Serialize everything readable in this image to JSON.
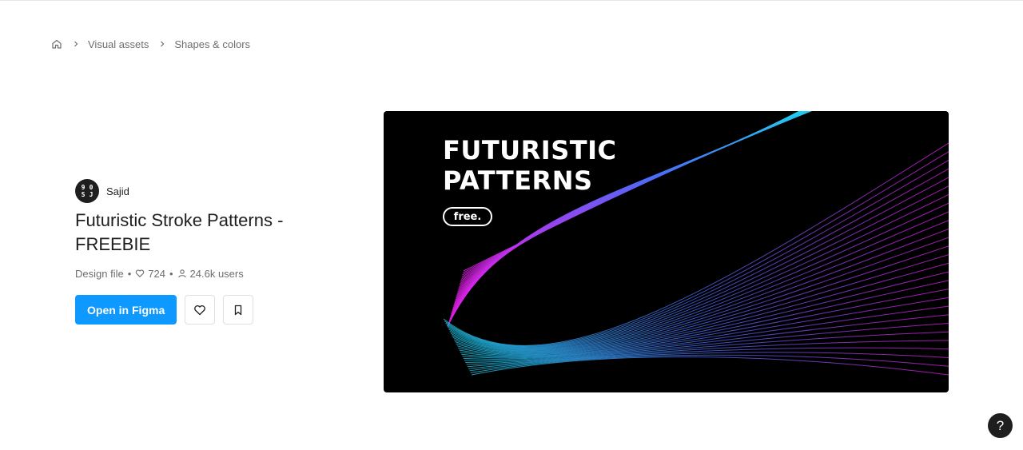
{
  "breadcrumb": {
    "home_icon": "home-icon",
    "items": [
      "Visual assets",
      "Shapes & colors"
    ]
  },
  "author": {
    "avatar_text": [
      "9",
      "0",
      "S",
      "J"
    ],
    "name": "Sajid"
  },
  "file": {
    "title": "Futuristic Stroke Patterns - FREEBIE",
    "type": "Design file",
    "likes": "724",
    "users": "24.6k users"
  },
  "actions": {
    "open_label": "Open in Figma",
    "like_icon": "heart-icon",
    "bookmark_icon": "bookmark-icon"
  },
  "hero": {
    "title_line1": "FUTURISTIC",
    "title_line2": "PATTERNS",
    "badge": "free."
  },
  "help": {
    "label": "?"
  },
  "colors": {
    "primary": "#0d99ff",
    "text": "#1e1e1e",
    "muted": "#6e6e6e",
    "wave_cyan": "#1fd1f0",
    "wave_blue": "#4a6cf7",
    "wave_magenta": "#e21ee6"
  }
}
